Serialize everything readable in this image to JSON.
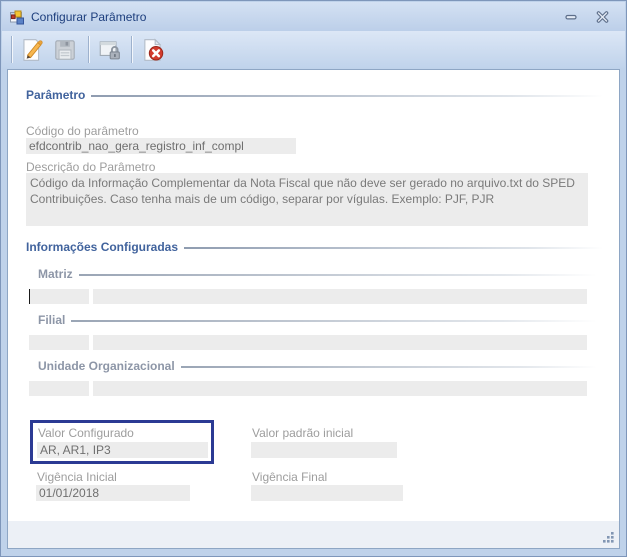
{
  "window": {
    "title": "Configurar Parâmetro",
    "icons": {
      "app": "winforms-app-icon",
      "minimize": "minimize-icon",
      "close": "close-icon"
    }
  },
  "toolbar": {
    "icons": [
      "edit-icon",
      "save-icon",
      "security-lock-icon",
      "cancel-icon"
    ]
  },
  "parametro_section": {
    "title": "Parâmetro",
    "codigo": {
      "label": "Código do parâmetro",
      "value": "efdcontrib_nao_gera_registro_inf_compl"
    },
    "descricao": {
      "label": "Descrição do Parâmetro",
      "value": "Código da Informação Complementar da Nota Fiscal que não deve ser gerado no arquivo.txt do SPED Contribuições. Caso tenha mais de um código, separar por vígulas. Exemplo: PJF, PJR"
    }
  },
  "informacoes_section": {
    "title": "Informações Configuradas",
    "groups": [
      {
        "label": "Matriz",
        "code": "",
        "name": ""
      },
      {
        "label": "Filial",
        "code": "",
        "name": ""
      },
      {
        "label": "Unidade Organizacional",
        "code": "",
        "name": ""
      }
    ]
  },
  "valores_section": {
    "valor_configurado": {
      "label": "Valor Configurado",
      "value": "AR, AR1, IP3"
    },
    "valor_padrao": {
      "label": "Valor padrão inicial",
      "value": ""
    },
    "vigencia_inicial": {
      "label": "Vigência Inicial",
      "value": "01/01/2018"
    },
    "vigencia_final": {
      "label": "Vigência Final",
      "value": ""
    }
  },
  "colors": {
    "highlight_border": "#2b3a94",
    "section_header": "#41639d",
    "subsection_header": "#8d96a7",
    "field_background": "#ececec",
    "frame": "#bfd2ea"
  }
}
